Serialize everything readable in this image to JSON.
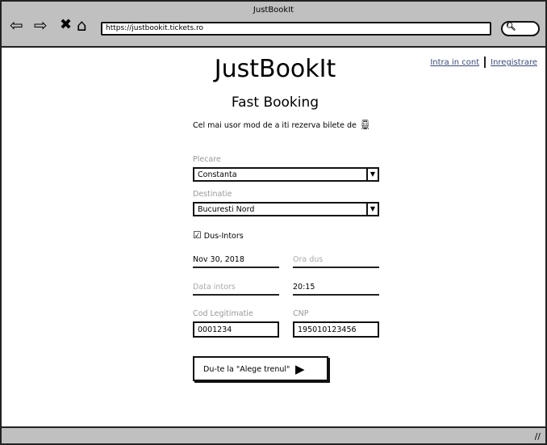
{
  "window": {
    "title": "JustBookIt",
    "url": "https://justbookit.tickets.ro"
  },
  "header": {
    "logo": "JustBookIt",
    "login_link": "Intra in cont",
    "register_link": "Inregistrare"
  },
  "main": {
    "title": "Fast Booking",
    "subtitle": "Cel mai usor mod de a iti rezerva bilete de"
  },
  "form": {
    "departure": {
      "label": "Plecare",
      "value": "Constanta"
    },
    "destination": {
      "label": "Destinatie",
      "value": "Bucuresti Nord"
    },
    "round_trip": {
      "label": "Dus-Intors",
      "checked": true
    },
    "departure_date": {
      "value": "Nov 30, 2018"
    },
    "departure_time": {
      "placeholder": "Ora dus"
    },
    "return_date": {
      "placeholder": "Data intors"
    },
    "return_time": {
      "value": "20:15"
    },
    "id_code": {
      "label": "Cod Legitimatie",
      "value": "0001234"
    },
    "cnp": {
      "label": "CNP",
      "value": "195010123456"
    },
    "submit_label": "Du-te la \"Alege trenul\""
  }
}
